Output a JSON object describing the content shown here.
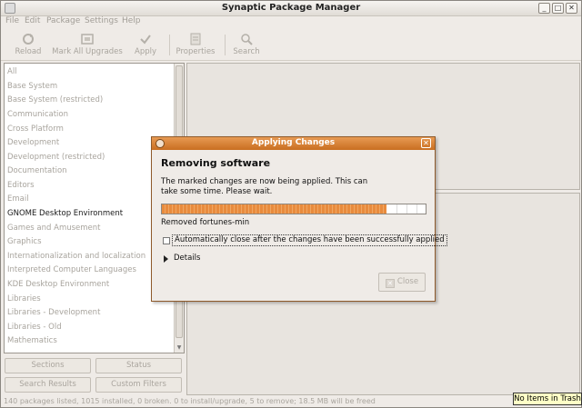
{
  "window": {
    "title": "Synaptic Package Manager"
  },
  "menu": [
    "File",
    "Edit",
    "Package",
    "Settings",
    "Help"
  ],
  "toolbar": {
    "reload": "Reload",
    "mark_all_upgrades": "Mark All Upgrades",
    "apply": "Apply",
    "properties": "Properties",
    "search": "Search"
  },
  "sections": [
    "All",
    "Base System",
    "Base System (restricted)",
    "Communication",
    "Cross Platform",
    "Development",
    "Development (restricted)",
    "Documentation",
    "Editors",
    "Email",
    "GNOME Desktop Environment",
    "Games and Amusement",
    "Graphics",
    "Internationalization and localization",
    "Interpreted Computer Languages",
    "KDE Desktop Environment",
    "Libraries",
    "Libraries - Development",
    "Libraries - Old",
    "Mathematics"
  ],
  "selected_section": "GNOME Desktop Environment",
  "filter_buttons": {
    "sections": "Sections",
    "status": "Status",
    "search_results": "Search Results",
    "custom_filters": "Custom Filters"
  },
  "statusbar": "140 packages listed, 1015 installed, 0 broken. 0 to install/upgrade, 5 to remove; 18.5 MB will be freed",
  "trash_tooltip": "No Items in Trash",
  "dialog": {
    "title": "Applying Changes",
    "heading": "Removing software",
    "message": "The marked changes are now being applied. This can take some time. Please wait.",
    "progress_fraction": 0.85,
    "progress_text": "Removed fortunes-min",
    "auto_close_label": "Automatically close after the changes have been successfully applied",
    "details_label": "Details",
    "close_label": "Close"
  },
  "colors": {
    "dialog_title": "#d47b2c",
    "progress": "#e88b3d",
    "tooltip_bg": "#ffffc6"
  }
}
